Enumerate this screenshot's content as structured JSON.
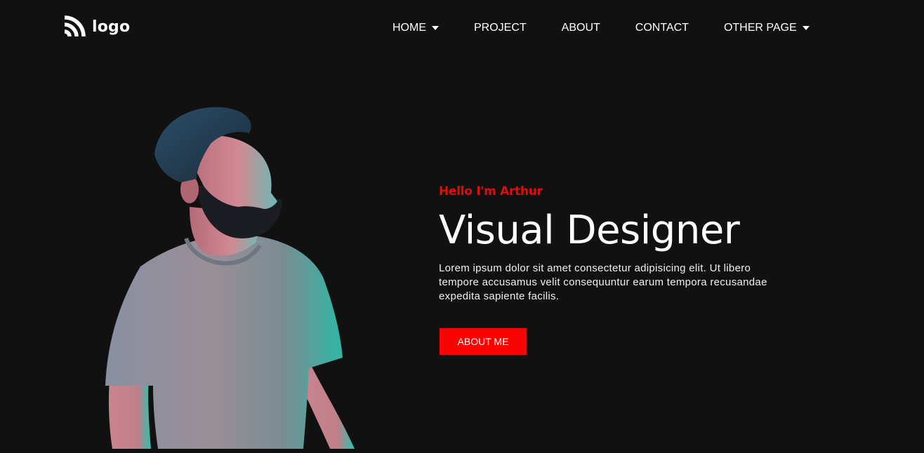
{
  "brand": {
    "logo_text": "logo"
  },
  "nav": {
    "items": [
      {
        "label": "HOME",
        "has_dropdown": true
      },
      {
        "label": "PROJECT",
        "has_dropdown": false
      },
      {
        "label": "ABOUT",
        "has_dropdown": false
      },
      {
        "label": "CONTACT",
        "has_dropdown": false
      },
      {
        "label": "OTHER PAGE",
        "has_dropdown": true
      }
    ]
  },
  "hero": {
    "greeting": "Hello I'm Arthur",
    "title": "Visual Designer",
    "description": "Lorem ipsum dolor sit amet consectetur adipisicing elit. Ut libero tempore accusamus velit consequuntur earum tempora recusandae expedita sapiente facilis.",
    "button_label": "ABOUT ME"
  },
  "colors": {
    "background": "#111111",
    "accent": "#ff0000",
    "greeting": "#e00d0d",
    "text": "#ffffff"
  }
}
